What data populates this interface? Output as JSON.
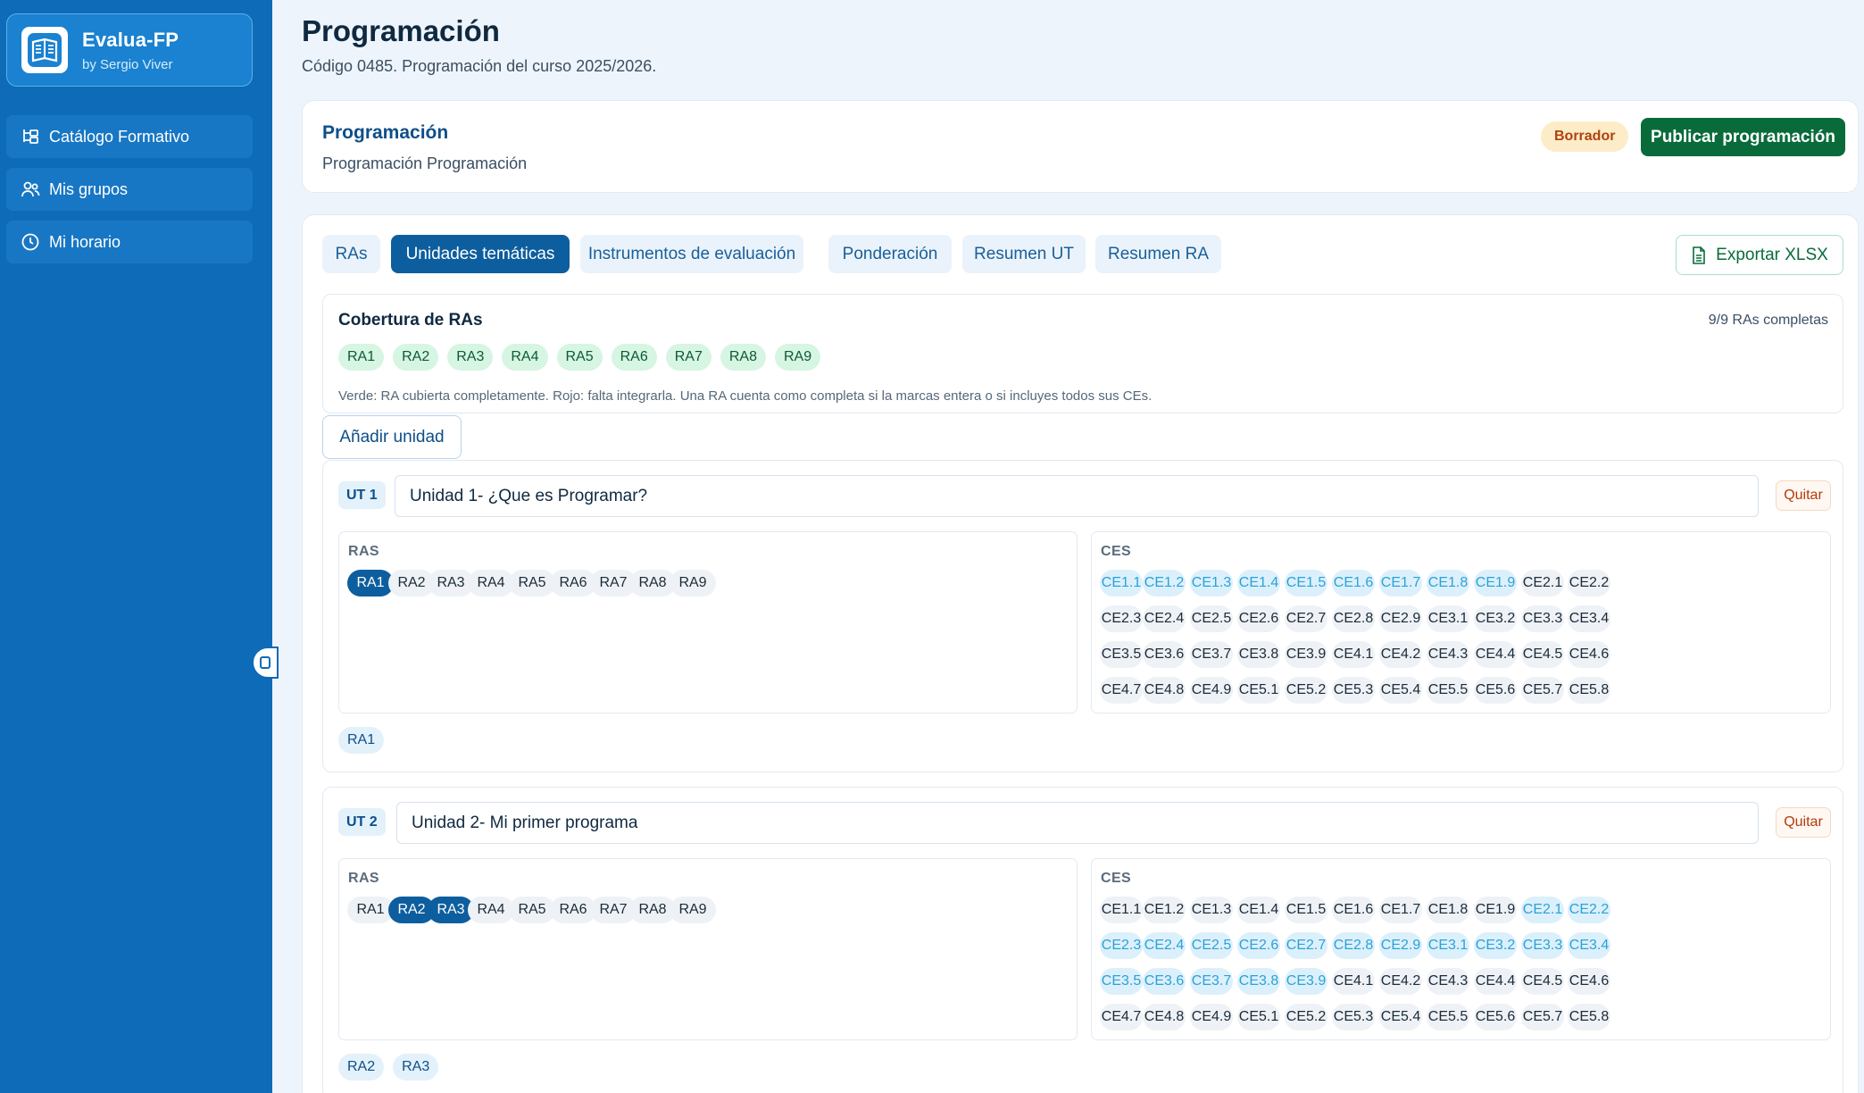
{
  "app": {
    "name": "Evalua-FP",
    "byline": "by Sergio Viver"
  },
  "sidebar": {
    "items": [
      {
        "label": "Catálogo Formativo",
        "icon": "hierarchy-icon"
      },
      {
        "label": "Mis grupos",
        "icon": "users-icon"
      },
      {
        "label": "Mi horario",
        "icon": "clock-icon"
      }
    ]
  },
  "header": {
    "title": "Programación",
    "subtitle": "Código 0485. Programación del curso 2025/2026."
  },
  "program_card": {
    "title": "Programación",
    "subtitle": "Programación Programación",
    "status": "Borrador",
    "publish_label": "Publicar programación"
  },
  "tabs": [
    {
      "label": "RAs",
      "active": false
    },
    {
      "label": "Unidades temáticas",
      "active": true
    },
    {
      "label": "Instrumentos de evaluación",
      "active": false
    },
    {
      "label": "Ponderación",
      "active": false
    },
    {
      "label": "Resumen UT",
      "active": false
    },
    {
      "label": "Resumen RA",
      "active": false
    }
  ],
  "export_label": "Exportar XLSX",
  "coverage": {
    "title": "Cobertura de RAs",
    "status": "9/9 RAs completas",
    "ras": [
      "RA1",
      "RA2",
      "RA3",
      "RA4",
      "RA5",
      "RA6",
      "RA7",
      "RA8",
      "RA9"
    ],
    "note": "Verde: RA cubierta completamente. Rojo: falta integrarla. Una RA cuenta como completa si la marcas entera o si incluyes todos sus CEs."
  },
  "add_unit_label": "Añadir unidad",
  "ras_label": "RAS",
  "ces_label": "CES",
  "remove_label": "Quitar",
  "ra_options": [
    "RA1",
    "RA2",
    "RA3",
    "RA4",
    "RA5",
    "RA6",
    "RA7",
    "RA8",
    "RA9"
  ],
  "ce_options": [
    "CE1.1",
    "CE1.2",
    "CE1.3",
    "CE1.4",
    "CE1.5",
    "CE1.6",
    "CE1.7",
    "CE1.8",
    "CE1.9",
    "CE2.1",
    "CE2.2",
    "CE2.3",
    "CE2.4",
    "CE2.5",
    "CE2.6",
    "CE2.7",
    "CE2.8",
    "CE2.9",
    "CE3.1",
    "CE3.2",
    "CE3.3",
    "CE3.4",
    "CE3.5",
    "CE3.6",
    "CE3.7",
    "CE3.8",
    "CE3.9",
    "CE4.1",
    "CE4.2",
    "CE4.3",
    "CE4.4",
    "CE4.5",
    "CE4.6",
    "CE4.7",
    "CE4.8",
    "CE4.9",
    "CE5.1",
    "CE5.2",
    "CE5.3",
    "CE5.4",
    "CE5.5",
    "CE5.6",
    "CE5.7",
    "CE5.8"
  ],
  "units": [
    {
      "tag": "UT 1",
      "name": "Unidad 1- ¿Que es Programar?",
      "selected_ras": [
        "RA1"
      ],
      "highlighted_ces": [
        "CE1.1",
        "CE1.2",
        "CE1.3",
        "CE1.4",
        "CE1.5",
        "CE1.6",
        "CE1.7",
        "CE1.8",
        "CE1.9"
      ],
      "summary": [
        "RA1"
      ]
    },
    {
      "tag": "UT 2",
      "name": "Unidad 2- Mi primer programa",
      "selected_ras": [
        "RA2",
        "RA3"
      ],
      "highlighted_ces": [
        "CE2.1",
        "CE2.2",
        "CE2.3",
        "CE2.4",
        "CE2.5",
        "CE2.6",
        "CE2.7",
        "CE2.8",
        "CE2.9",
        "CE3.1",
        "CE3.2",
        "CE3.3",
        "CE3.4",
        "CE3.5",
        "CE3.6",
        "CE3.7",
        "CE3.8",
        "CE3.9"
      ],
      "summary": [
        "RA2",
        "RA3"
      ]
    }
  ]
}
